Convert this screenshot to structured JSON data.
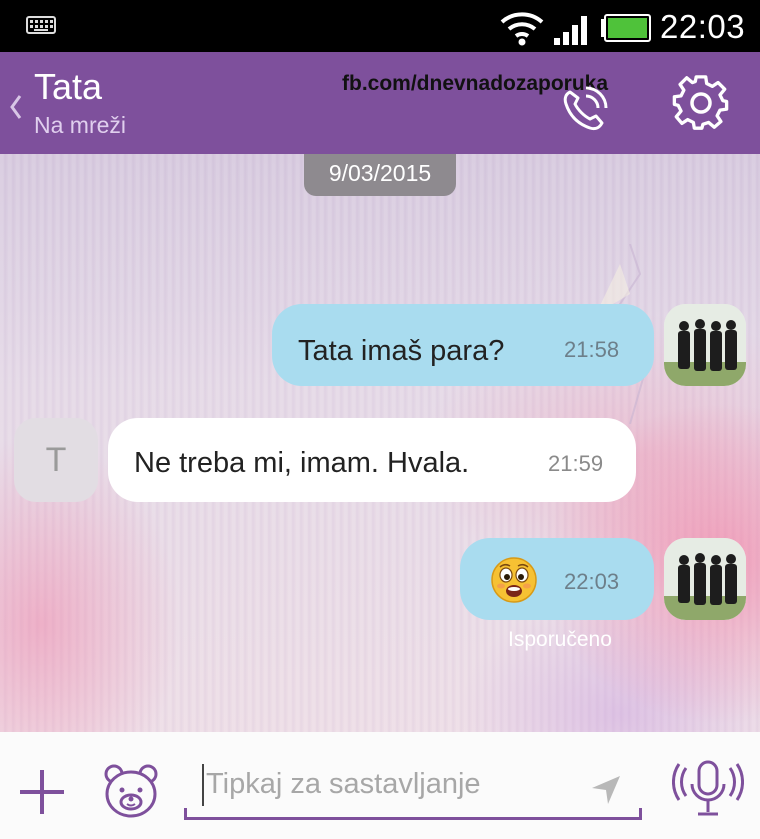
{
  "status_bar": {
    "time": "22:03",
    "icons": [
      "keyboard-icon",
      "wifi-icon",
      "signal-icon",
      "battery-icon"
    ]
  },
  "header": {
    "contact_name": "Tata",
    "contact_status": "Na mreži",
    "watermark": "fb.com/dnevnadozaporuka",
    "icons": [
      "back-icon",
      "call-icon",
      "gear-icon"
    ]
  },
  "chat": {
    "date": "9/03/2015",
    "messages": [
      {
        "direction": "outgoing",
        "text": "Tata imaš para?",
        "time": "21:58"
      },
      {
        "direction": "incoming",
        "text": "Ne treba mi, imam. Hvala.",
        "time": "21:59",
        "avatar_letter": "T"
      },
      {
        "direction": "outgoing",
        "text": "",
        "emoji": "worried-face-emoji",
        "time": "22:03",
        "status": "Isporučeno"
      }
    ]
  },
  "input": {
    "placeholder": "Tipkaj za sastavljanje",
    "icons": [
      "plus-icon",
      "sticker-icon",
      "send-icon",
      "mic-icon"
    ]
  },
  "colors": {
    "header_purple": "#7e509c",
    "outgoing_bubble": "#a9dcef",
    "incoming_bubble": "#ffffff"
  }
}
